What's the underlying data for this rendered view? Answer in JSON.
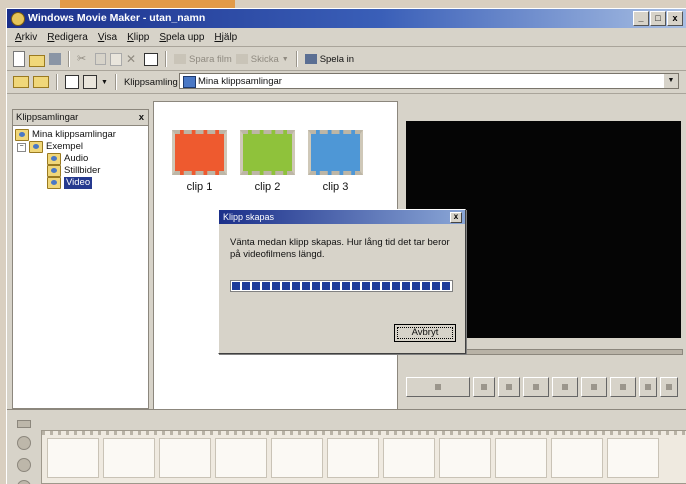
{
  "window": {
    "title": "Windows Movie Maker - utan_namn",
    "minimize": "_",
    "restore": "□",
    "close": "x"
  },
  "menu": [
    "Arkiv",
    "Redigera",
    "Visa",
    "Klipp",
    "Spela upp",
    "Hjälp"
  ],
  "toolbar": {
    "save_movie": "Spara film",
    "send": "Skicka",
    "record": "Spela in"
  },
  "collection_bar": {
    "label": "Klippsamling",
    "selected": "Mina klippsamlingar"
  },
  "tree_panel": {
    "title": "Klippsamlingar",
    "close": "x",
    "items": [
      {
        "label": "Mina klippsamlingar",
        "level": 0
      },
      {
        "label": "Exempel",
        "level": 1
      },
      {
        "label": "Audio",
        "level": 2
      },
      {
        "label": "Stillbider",
        "level": 2
      },
      {
        "label": "Video",
        "level": 2,
        "selected": true
      }
    ]
  },
  "clips": [
    {
      "label": "clip 1",
      "color": "#ee5a2f"
    },
    {
      "label": "clip 2",
      "color": "#8fc23b"
    },
    {
      "label": "clip 3",
      "color": "#4e97d6"
    }
  ],
  "dialog": {
    "title": "Klipp skapas",
    "close": "x",
    "message": "Vänta medan klipp skapas. Hur lång tid det tar beror på videofilmens längd.",
    "button": "Avbryt",
    "progress": 1.0
  },
  "colors": {
    "titlebar": "#1b2f8a",
    "progress": "#1d3b9a",
    "preview": "#050505"
  }
}
